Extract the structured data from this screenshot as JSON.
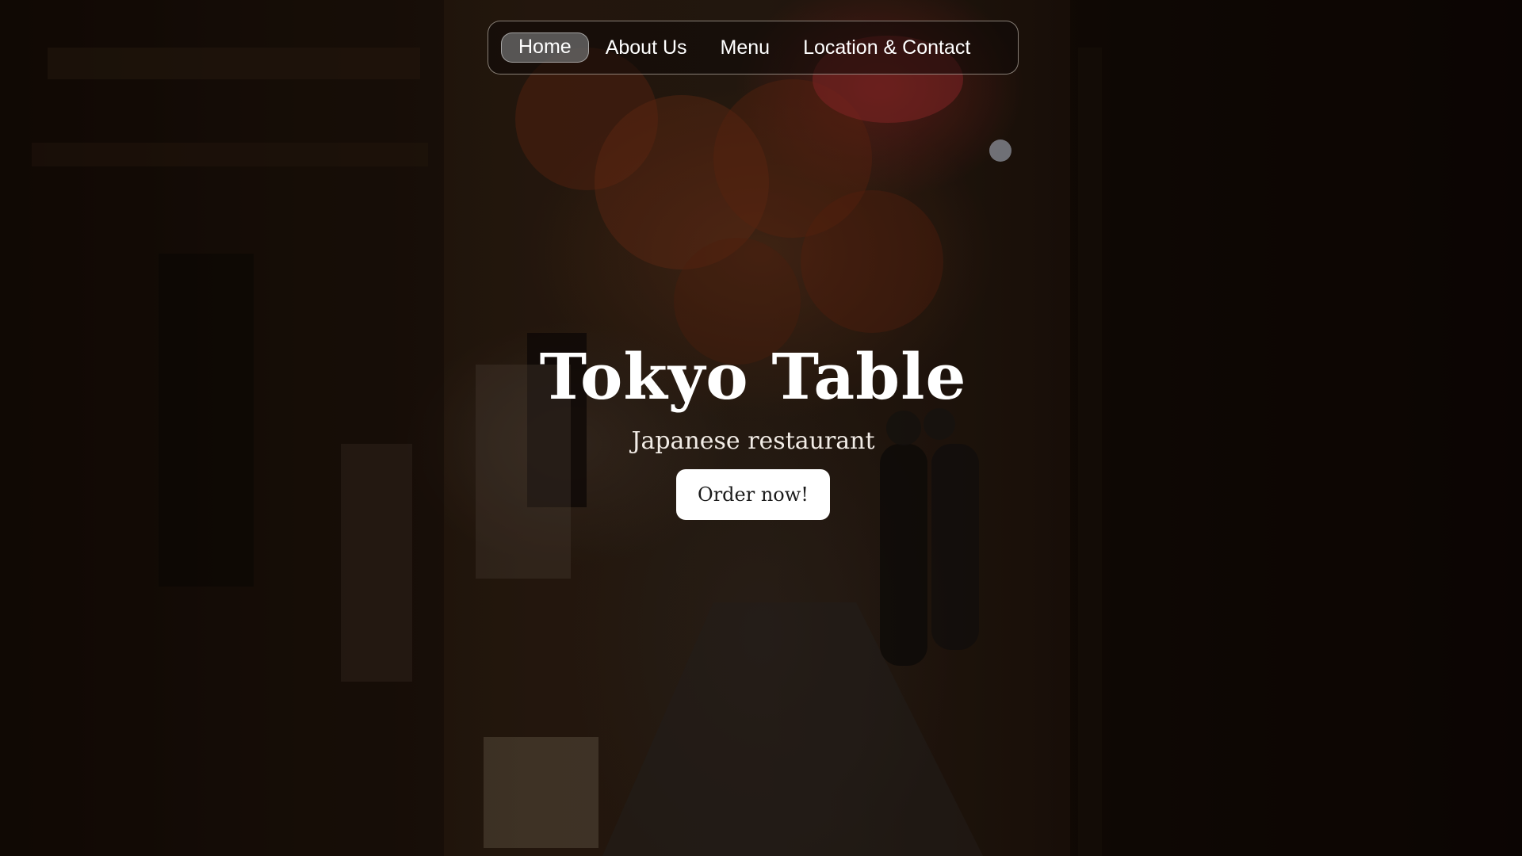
{
  "nav": {
    "items": [
      {
        "label": "Home",
        "active": true
      },
      {
        "label": "About Us",
        "active": false
      },
      {
        "label": "Menu",
        "active": false
      },
      {
        "label": "Location & Contact",
        "active": false
      }
    ]
  },
  "hero": {
    "title": "Tokyo Table",
    "subtitle": "Japanese restaurant",
    "cta_label": "Order now!"
  },
  "colors": {
    "text": "#ffffff",
    "button_bg": "#ffffff",
    "button_text": "#1a1a1a",
    "background": "#1a0f08"
  }
}
